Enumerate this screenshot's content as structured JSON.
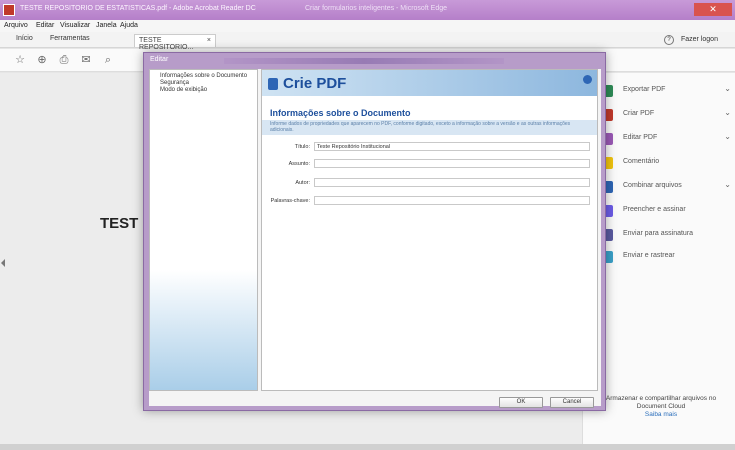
{
  "window": {
    "title": "TESTE REPOSITORIO DE ESTATISTICAS.pdf - Adobe Acrobat Reader DC",
    "caption": "Criar formularios inteligentes - Microsoft Edge",
    "control_label": "✕"
  },
  "menubar": [
    "Arquivo",
    "Editar",
    "Visualizar",
    "Janela",
    "Ajuda"
  ],
  "tabs": {
    "home": "Início",
    "tools": "Ferramentas",
    "document": "TESTE REPOSITORIO...",
    "document_close": "×"
  },
  "account": {
    "help_icon": "?",
    "signin": "Fazer logon"
  },
  "toolbar_glyphs": [
    "☆",
    "⊕",
    "⎙",
    "✉",
    "⌕"
  ],
  "document": {
    "page_text": "TEST"
  },
  "dialog": {
    "title": "Editar",
    "nav_items": [
      "Informações sobre o Documento",
      "Segurança",
      "Modo de exibição"
    ],
    "banner_title": "Crie PDF",
    "section_title": "Informações sobre o Documento",
    "description": "Informe dados de propriedades que aparecem no PDF, conforme digitado, exceto a informação sobre a versão e as outras informações adicionais.",
    "fields": [
      {
        "label": "Título:",
        "value": "Teste Repositório Institucional"
      },
      {
        "label": "Assunto:",
        "value": ""
      },
      {
        "label": "Autor:",
        "value": ""
      },
      {
        "label": "Palavras-chave:",
        "value": ""
      }
    ],
    "ok_label": "OK",
    "cancel_label": "Cancel"
  },
  "tools_pane": [
    {
      "label": "Exportar PDF",
      "chevron": "⌄",
      "color": "#2e8b57"
    },
    {
      "label": "Criar PDF",
      "chevron": "⌄",
      "color": "#c0392b"
    },
    {
      "label": "Editar PDF",
      "chevron": "⌄",
      "color": "#9b59b6"
    },
    {
      "label": "Comentário",
      "chevron": "",
      "color": "#f1c40f"
    },
    {
      "label": "Combinar arquivos",
      "chevron": "⌄",
      "color": "#2e66b5"
    },
    {
      "label": "Preencher e assinar",
      "chevron": "",
      "color": "#6c5ce7"
    },
    {
      "label": "Enviar para assinatura",
      "chevron": "",
      "color": "#5a5aa0"
    },
    {
      "label": "Enviar e rastrear",
      "chevron": "",
      "color": "#3aa0c8"
    }
  ],
  "promo": {
    "text": "Armazenar e compartilhar arquivos no Document Cloud",
    "link": "Saiba mais"
  }
}
